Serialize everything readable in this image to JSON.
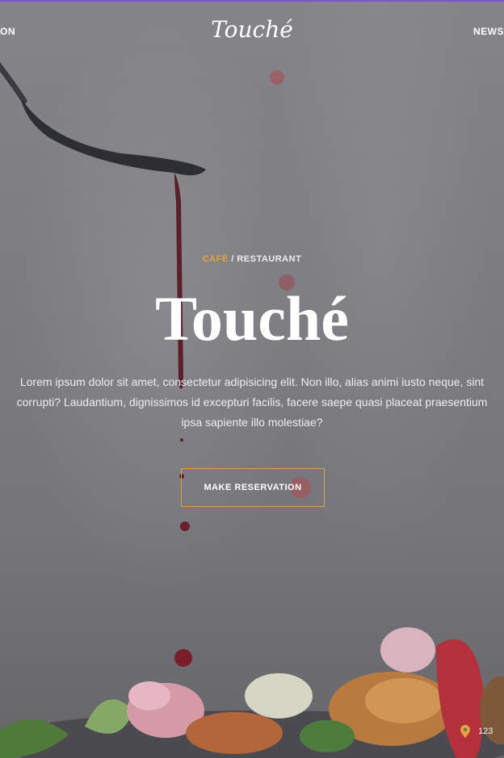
{
  "topbar": {
    "accent": "#7b55c8"
  },
  "nav": {
    "left_item": "ON",
    "right_item": "NEWS"
  },
  "logo": {
    "text": "Touché"
  },
  "hero": {
    "category_accent": "CAFÉ",
    "category_rest": " / RESTAURANT",
    "title": "Touché",
    "description": "Lorem ipsum dolor sit amet, consectetur adipisicing elit. Non illo, alias animi iusto neque, sint corrupti? Laudantium, dignissimos id excepturi facilis, facere saepe quasi placeat praesentium ipsa sapiente illo molestiae?",
    "cta_label": "MAKE RESERVATION"
  },
  "contact": {
    "icon": "map-pin-icon",
    "text": "123"
  },
  "colors": {
    "accent": "#e6a23c",
    "button_border": "#d9a54b"
  }
}
